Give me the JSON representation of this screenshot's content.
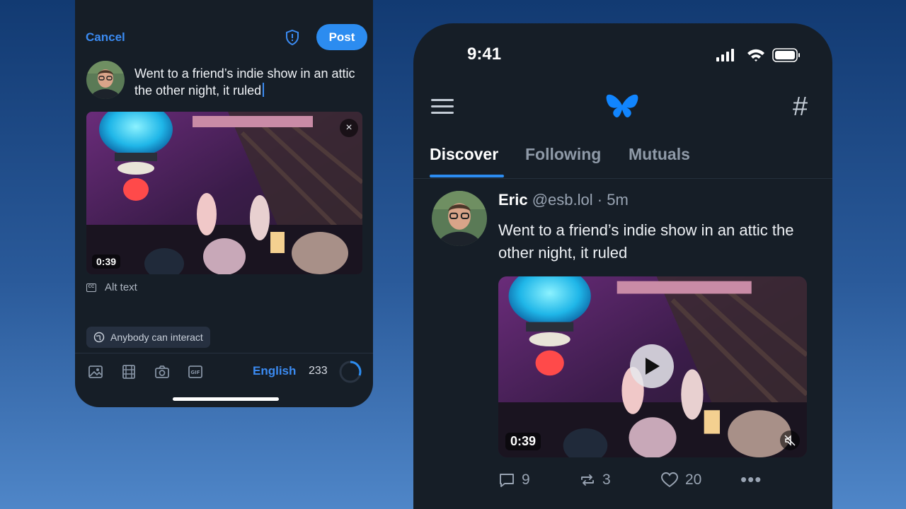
{
  "composer": {
    "cancel_label": "Cancel",
    "post_label": "Post",
    "text": "Went to a friend’s indie show in an attic the other night, it ruled",
    "video_duration": "0:39",
    "close_icon": "×",
    "alt_text_label": "Alt text",
    "cc_label": "CC",
    "interaction_label": "Anybody can interact",
    "language": "English",
    "char_count": "233",
    "gif_label": "GIF"
  },
  "feed": {
    "status_time": "9:41",
    "tabs": [
      {
        "label": "Discover",
        "active": true
      },
      {
        "label": "Following",
        "active": false
      },
      {
        "label": "Mutuals",
        "active": false
      }
    ],
    "hash_icon": "#",
    "post": {
      "author": "Eric",
      "handle": "@esb.lol",
      "separator": "·",
      "time": "5m",
      "text": "Went to a friend’s indie show in an attic the other night, it ruled",
      "video_duration": "0:39",
      "replies": "9",
      "reposts": "3",
      "likes": "20",
      "more_icon": "•••"
    }
  },
  "colors": {
    "accent": "#2c8cf0",
    "panel": "#161e27",
    "muted": "#99a4b3"
  }
}
